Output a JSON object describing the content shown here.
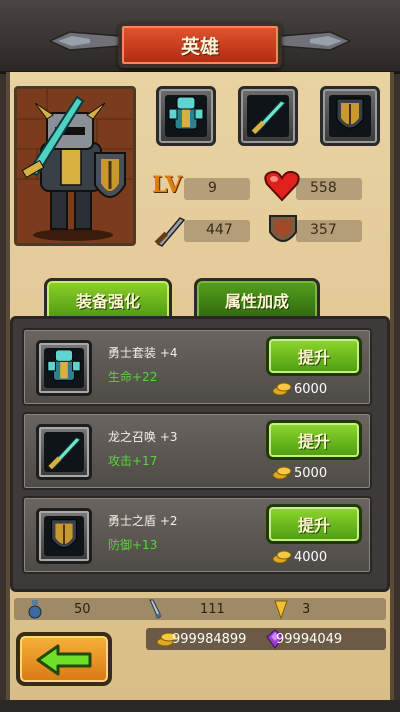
{
  "header": {
    "title": "英雄"
  },
  "hero": {
    "level_label": "LV",
    "level": "9",
    "hp": "558",
    "attack": "447",
    "defense": "357"
  },
  "tabs": [
    {
      "label": "装备强化",
      "active": true
    },
    {
      "label": "属性加成",
      "active": false
    }
  ],
  "equipment": [
    {
      "name": "勇士套装 +4",
      "bonus": "生命+22",
      "button": "提升",
      "cost": "6000",
      "icon": "armor-icon"
    },
    {
      "name": "龙之召唤 +3",
      "bonus": "攻击+17",
      "button": "提升",
      "cost": "5000",
      "icon": "sword-icon"
    },
    {
      "name": "勇士之盾 +2",
      "bonus": "防御+13",
      "button": "提升",
      "cost": "4000",
      "icon": "shield-icon"
    }
  ],
  "resources": {
    "potion": "50",
    "sword_stone": "111",
    "crystal": "3",
    "gold": "999984899",
    "gems": "99994049"
  },
  "colors": {
    "accent_green": "#6cc01e",
    "title_red": "#c8391a",
    "parchment": "#e0c894",
    "bonus_green": "#5cd23a"
  }
}
